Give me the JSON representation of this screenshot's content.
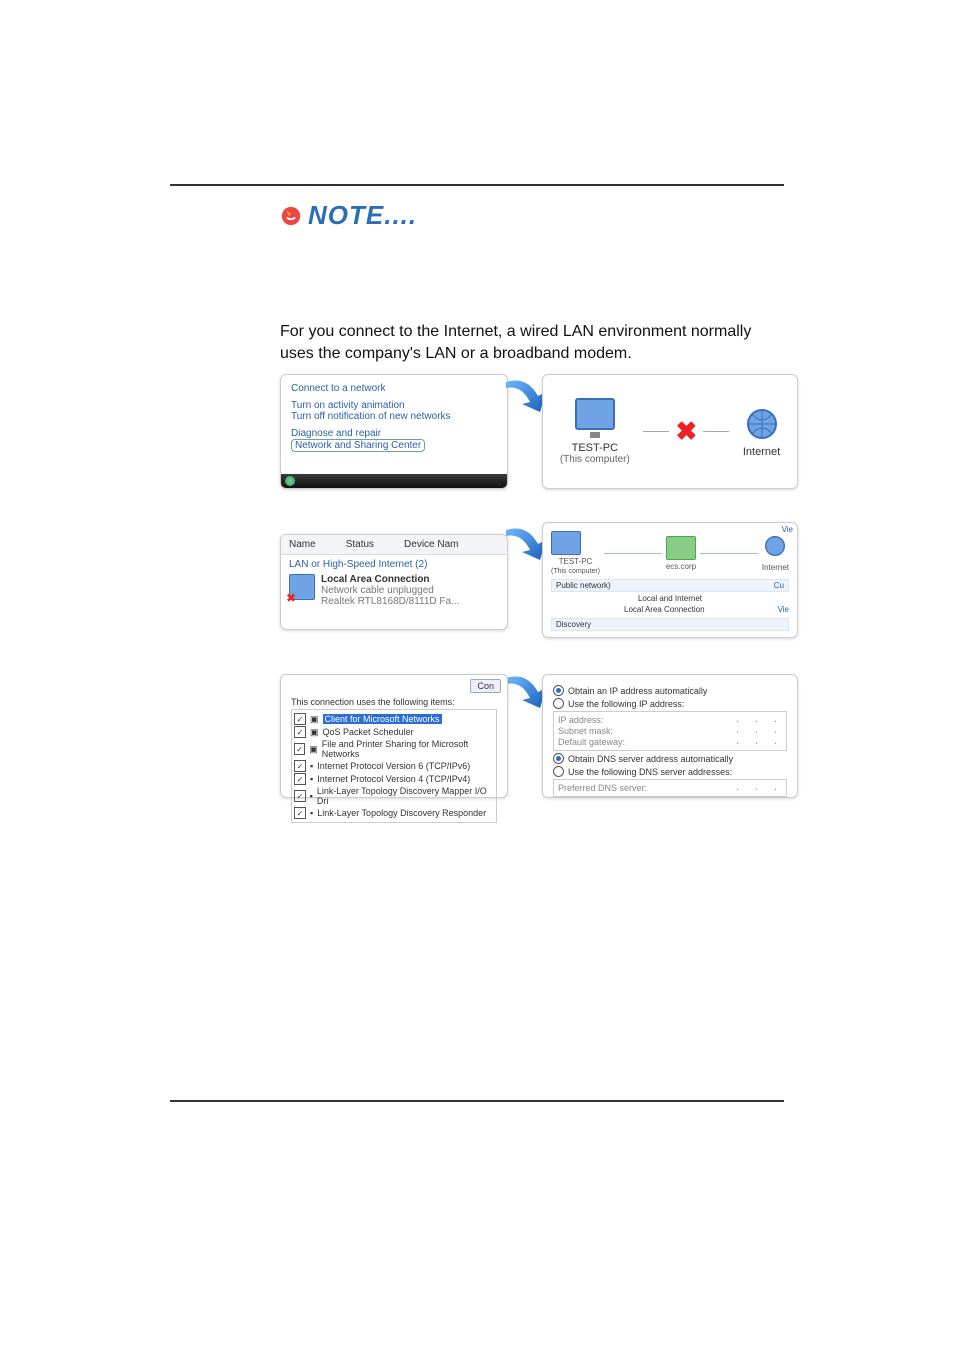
{
  "document": {
    "note_label": "NOTE....",
    "lead_text": "For you connect to the Internet, a wired LAN environment normally uses the company's LAN or a broadband modem."
  },
  "panel1": {
    "link_connect": "Connect to a network",
    "link_anim": "Turn on activity animation",
    "link_notify": "Turn off notification of new networks",
    "link_diag": "Diagnose and repair",
    "link_center": "Network and Sharing Center"
  },
  "panel2": {
    "left_title": "TEST-PC",
    "left_sub": "(This computer)",
    "right_title": "Internet"
  },
  "panel3": {
    "col_name": "Name",
    "col_status": "Status",
    "col_device": "Device Nam",
    "group": "LAN or High-Speed Internet (2)",
    "conn_title": "Local Area Connection",
    "conn_status": "Network cable unplugged",
    "conn_device": "Realtek RTL8168D/8111D Fa..."
  },
  "panel4": {
    "pc_name": "TEST-PC",
    "pc_sub": "(This computer)",
    "mid_name": "ecs.corp",
    "right_name": "Internet",
    "pub": "Public network)",
    "access_label": "Local and Internet",
    "conn_label": "Local Area Connection",
    "discovery": "Discovery",
    "cu": "Cu",
    "vie": "Vie",
    "vie_top": "Vie"
  },
  "panel5": {
    "intro": "This connection uses the following items:",
    "btn": "Con",
    "items": [
      "Client for Microsoft Networks",
      "QoS Packet Scheduler",
      "File and Printer Sharing for Microsoft Networks",
      "Internet Protocol Version 6 (TCP/IPv6)",
      "Internet Protocol Version 4 (TCP/IPv4)",
      "Link-Layer Topology Discovery Mapper I/O Dri",
      "Link-Layer Topology Discovery Responder"
    ]
  },
  "panel6": {
    "r1": "Obtain an IP address automatically",
    "r2": "Use the following IP address:",
    "ip": "IP address:",
    "mask": "Subnet mask:",
    "gw": "Default gateway:",
    "r3": "Obtain DNS server address automatically",
    "r4": "Use the following DNS server addresses:",
    "pref": "Preferred DNS server:"
  }
}
